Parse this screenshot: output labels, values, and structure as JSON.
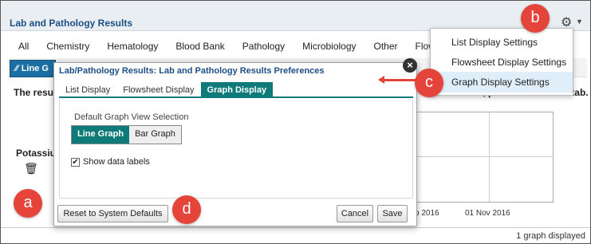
{
  "app": {
    "title": "Lab and Pathology Results"
  },
  "tabs": [
    "All",
    "Chemistry",
    "Hematology",
    "Blood Bank",
    "Pathology",
    "Microbiology",
    "Other",
    "Flowshee"
  ],
  "view_toggle": {
    "line_label": "Line G"
  },
  "content": {
    "note_left": "The resu",
    "note_right": "e results, please use the All tab.",
    "test_name": "Potassiu",
    "dates": [
      "p 2016",
      "01 Nov 2016"
    ],
    "status": "1 graph displayed"
  },
  "settings_menu": {
    "items": [
      "List Display Settings",
      "Flowsheet Display Settings",
      "Graph Display Settings"
    ],
    "highlighted_index": 2
  },
  "modal": {
    "title": "Lab/Pathology Results: Lab and Pathology Results Preferences",
    "tabs": [
      "List Display",
      "Flowsheet Display",
      "Graph Display"
    ],
    "active_tab_index": 2,
    "default_view_label": "Default Graph View Selection",
    "graph_options": [
      "Line Graph",
      "Bar Graph"
    ],
    "selected_graph": "Line Graph",
    "show_labels": {
      "label": "Show data labels",
      "checked": true
    },
    "buttons": {
      "reset": "Reset to System Defaults",
      "cancel": "Cancel",
      "save": "Save"
    }
  },
  "callouts": [
    "a",
    "b",
    "c",
    "d"
  ],
  "colors": {
    "accent_teal": "#0e7a7a",
    "title_blue": "#1d4f86",
    "callout_red": "#e5443b",
    "menu_highlight": "#dfeef8"
  },
  "icons": {
    "settings": "gear-icon",
    "close": "close-icon",
    "delete": "trash-icon",
    "graph": "line-graph-icon"
  }
}
